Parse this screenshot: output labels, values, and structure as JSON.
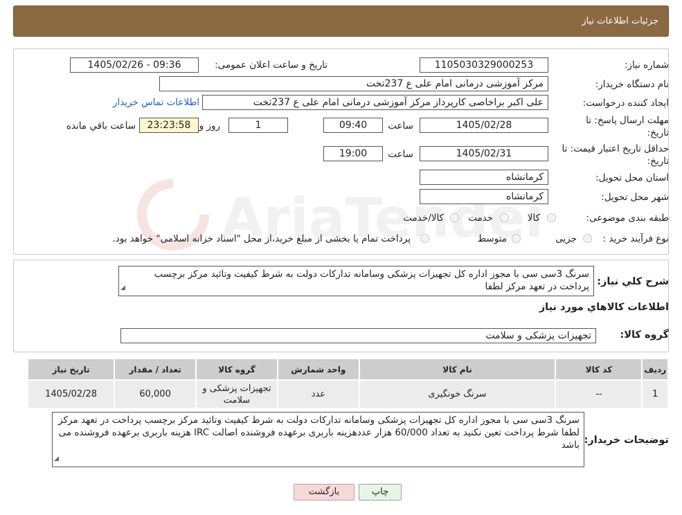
{
  "header": {
    "title": "جزئیات اطلاعات نیاز"
  },
  "details": {
    "need_number_label": "شماره نیاز:",
    "need_number": "1105030329000253",
    "announce_label": "تاریخ و ساعت اعلان عمومی:",
    "announce_value": "1405/02/26 - 09:36",
    "buyer_org_label": "نام دستگاه خریدار:",
    "buyer_org": "مرکز آموزشی درمانی امام علی ع 237تخت",
    "creator_label": "ایجاد کننده درخواست:",
    "creator": "علی اکبر براخاصی کارپرداز  مرکز آموزشی درمانی امام علی ع 237تخت",
    "contact_link": "اطلاعات تماس خریدار",
    "deadline_label": "مهلت ارسال پاسخ: تا تاریخ:",
    "deadline_date": "1405/02/28",
    "time_label": "ساعت",
    "deadline_time": "09:40",
    "days_value": "1",
    "days_label": "روز و",
    "remaining_time": "23:23:58",
    "remaining_label": "ساعت باقي مانده",
    "validity_label": "حداقل تاریخ اعتبار قیمت: تا تاریخ:",
    "validity_date": "1405/02/31",
    "validity_time_label": "ساعت",
    "validity_time": "19:00",
    "province_label": "استان محل تحویل:",
    "province": "کرمانشاه",
    "city_label": "شهر محل تحویل:",
    "city": "کرمانشاه",
    "category_label": "طبقه بندی موضوعی:",
    "category_options": [
      "کالا",
      "خدمت",
      "کالا/خدمت"
    ],
    "process_label": "نوع فرآیند خرید :",
    "process_options": [
      "جزیی",
      "متوسط"
    ],
    "process_note": "پرداخت تمام یا بخشی از مبلغ خرید،از محل \"اسناد خزانه اسلامی\" خواهد بود."
  },
  "summary": {
    "description_label": "شرح کلي نياز:",
    "description": "سرنگ 3سی سی با مجوز اداره کل تجهیزات پزشکی  وسامانه تدارکات دولت به شرط کیفیت وتائید مرکز برچسب پرداخت در تعهد مرکز  لطفا",
    "items_title": "اطلاعات کالاهاي مورد نياز",
    "group_label": "گروه کالا:",
    "group_value": "تجهیزات پزشکی و سلامت"
  },
  "table": {
    "headers": [
      "ردیف",
      "کد کالا",
      "نام کالا",
      "واحد شمارش",
      "گروه کالا",
      "تعداد / مقدار",
      "تاریخ نیاز"
    ],
    "rows": [
      [
        "1",
        "--",
        "سرنگ خونگیری",
        "عدد",
        "تجهیزات پزشکی و سلامت",
        "60,000",
        "1405/02/28"
      ]
    ]
  },
  "buyer_notes": {
    "label": "توضیحات خریدار:",
    "text": "سرنگ 3سی سی با مجوز اداره کل تجهیزات پزشکی  وسامانه تدارکات دولت به شرط کیفیت وتائید مرکز برچسب پرداخت در تعهد مرکز  لطفا شرط پرداخت تعین نکنید به تعداد 60/000 هزار عددهزینه باربری برعهده فروشنده  اصالت  IRC هزینه باربری برعهده فروشنده می باشد"
  },
  "buttons": {
    "print": "چاپ",
    "back": "بازگشت"
  },
  "watermark": {
    "text": "AriaTender.neT"
  },
  "colors": {
    "header_bg": "#8b6a43",
    "link": "#1a5fd0",
    "highlight": "#fdf7cc",
    "back_btn": "#f8d9d9",
    "print_btn": "#e6f5e6"
  }
}
